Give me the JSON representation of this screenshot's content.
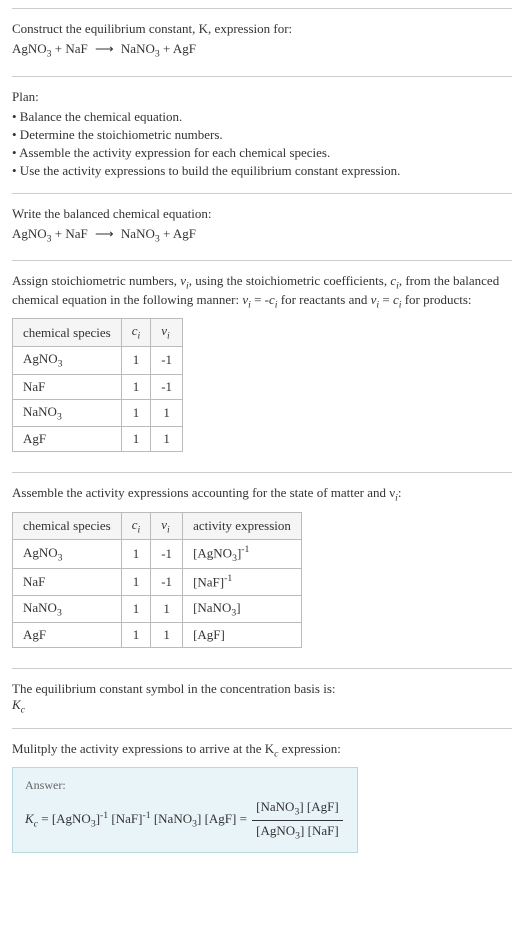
{
  "prompt": {
    "line1": "Construct the equilibrium constant, K, expression for:",
    "equation_lhs1": "AgNO",
    "equation_lhs2": "NaF",
    "equation_rhs1": "NaNO",
    "equation_rhs2": "AgF"
  },
  "plan": {
    "title": "Plan:",
    "items": [
      "• Balance the chemical equation.",
      "• Determine the stoichiometric numbers.",
      "• Assemble the activity expression for each chemical species.",
      "• Use the activity expressions to build the equilibrium constant expression."
    ]
  },
  "balanced": {
    "title": "Write the balanced chemical equation:"
  },
  "stoich": {
    "intro1": "Assign stoichiometric numbers, ",
    "intro2": ", using the stoichiometric coefficients, ",
    "intro3": ", from the balanced chemical equation in the following manner: ",
    "intro4": " for reactants and ",
    "intro5": " for products:",
    "headers": {
      "species": "chemical species",
      "ci": "c",
      "vi": "ν"
    },
    "rows": [
      {
        "species": "AgNO",
        "sub": "3",
        "ci": "1",
        "vi": "-1"
      },
      {
        "species": "NaF",
        "sub": "",
        "ci": "1",
        "vi": "-1"
      },
      {
        "species": "NaNO",
        "sub": "3",
        "ci": "1",
        "vi": "1"
      },
      {
        "species": "AgF",
        "sub": "",
        "ci": "1",
        "vi": "1"
      }
    ]
  },
  "activity": {
    "title": "Assemble the activity expressions accounting for the state of matter and ν",
    "title_suffix": ":",
    "headers": {
      "species": "chemical species",
      "ci": "c",
      "vi": "ν",
      "expr": "activity expression"
    },
    "rows": [
      {
        "species": "AgNO",
        "sub": "3",
        "ci": "1",
        "vi": "-1",
        "expr": "[AgNO",
        "expr_sub": "3",
        "expr_sup": "-1"
      },
      {
        "species": "NaF",
        "sub": "",
        "ci": "1",
        "vi": "-1",
        "expr": "[NaF]",
        "expr_sub": "",
        "expr_sup": "-1"
      },
      {
        "species": "NaNO",
        "sub": "3",
        "ci": "1",
        "vi": "1",
        "expr": "[NaNO",
        "expr_sub": "3",
        "expr_sup": ""
      },
      {
        "species": "AgF",
        "sub": "",
        "ci": "1",
        "vi": "1",
        "expr": "[AgF]",
        "expr_sub": "",
        "expr_sup": ""
      }
    ]
  },
  "symbol": {
    "line1": "The equilibrium constant symbol in the concentration basis is:",
    "line2": "K"
  },
  "multiply": {
    "title": "Mulitply the activity expressions to arrive at the K",
    "title_suffix": " expression:"
  },
  "answer": {
    "label": "Answer:"
  }
}
